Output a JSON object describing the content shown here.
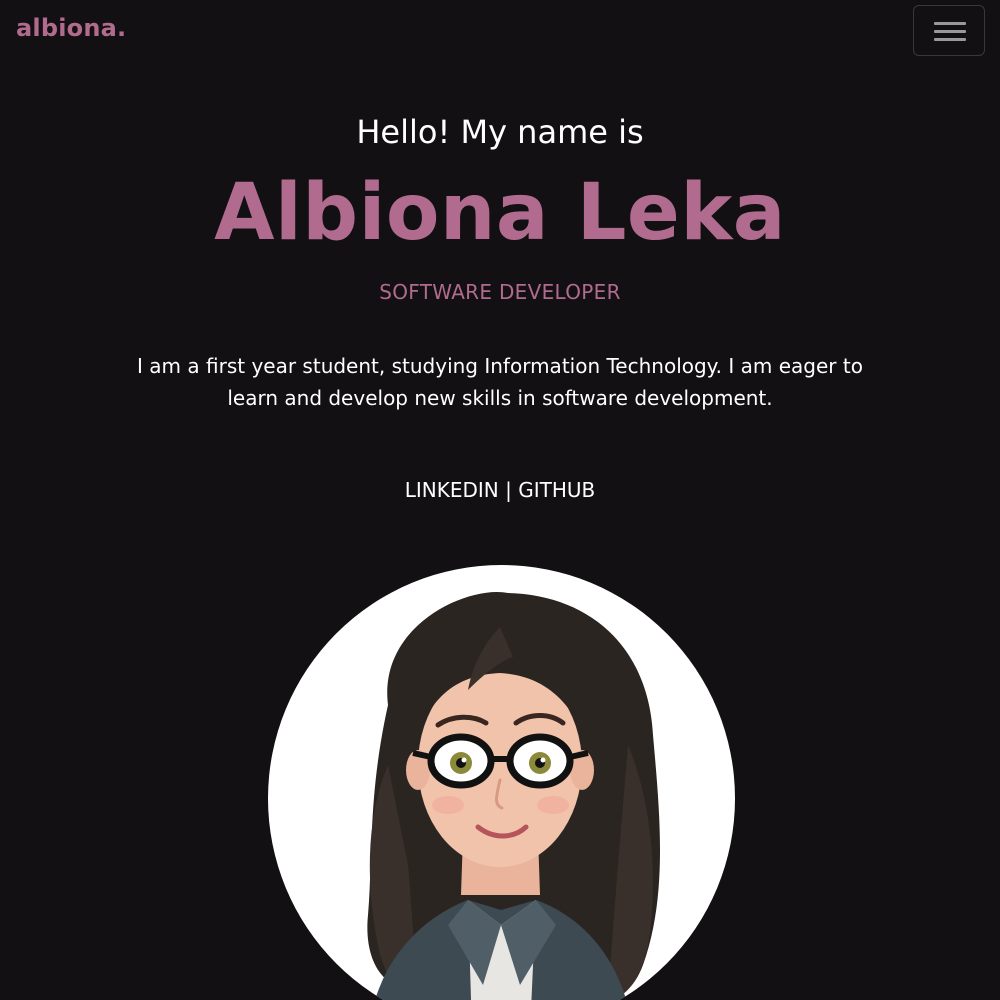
{
  "header": {
    "brand": "albiona.",
    "menu_icon": "hamburger-menu-icon"
  },
  "hero": {
    "greeting": "Hello! My name is",
    "name": "Albiona Leka",
    "role": "SOFTWARE DEVELOPER",
    "bio": "I am a first year student, studying Information Technology. I am eager to learn and develop new skills in software development.",
    "links": {
      "linkedin": "LINKEDIN",
      "separator": " | ",
      "github": "GITHUB"
    }
  },
  "avatar": {
    "alt": "cartoon avatar",
    "icon": "avatar-illustration"
  },
  "colors": {
    "background": "#121012",
    "accent": "#b06b8f",
    "text": "#ffffff"
  }
}
